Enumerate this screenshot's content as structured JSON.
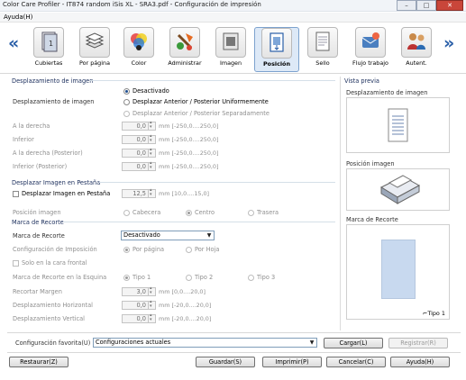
{
  "window": {
    "title": "Color Care Profiler - IT874 random iSis XL - SRA3.pdf - Configuración de impresión",
    "min": "–",
    "max": "□",
    "close": "✕"
  },
  "menu": {
    "help": "Ayuda(H)"
  },
  "toolbar": {
    "prev": "«",
    "next": "»",
    "items": [
      {
        "label": "Cubiertas",
        "icon": "cover-icon"
      },
      {
        "label": "Por página",
        "icon": "per-page-icon"
      },
      {
        "label": "Color",
        "icon": "color-icon"
      },
      {
        "label": "Administrar",
        "icon": "manage-icon"
      },
      {
        "label": "Imagen",
        "icon": "image-icon"
      },
      {
        "label": "Posición",
        "icon": "position-icon",
        "selected": true
      },
      {
        "label": "Sello",
        "icon": "stamp-icon"
      },
      {
        "label": "Flujo trabajo",
        "icon": "workflow-icon"
      },
      {
        "label": "Autent.",
        "icon": "authentication-icon"
      }
    ]
  },
  "image_shift": {
    "header": "Desplazamiento de imagen",
    "label": "Desplazamiento de imagen",
    "options": [
      "Desactivado",
      "Desplazar Anterior / Posterior Uniformemente",
      "Desplazar Anterior / Posterior Separadamente"
    ],
    "fields": [
      {
        "label": "A la derecha",
        "value": "0,0",
        "range": "mm [-250,0....250,0]"
      },
      {
        "label": "Inferior",
        "value": "0,0",
        "range": "mm [-250,0....250,0]"
      },
      {
        "label": "A la derecha (Posterior)",
        "value": "0,0",
        "range": "mm [-250,0....250,0]"
      },
      {
        "label": "Inferior (Posterior)",
        "value": "0,0",
        "range": "mm [-250,0....250,0]"
      }
    ]
  },
  "tab_shift": {
    "header": "Desplazar Imagen en Pestaña",
    "checkbox": "Desplazar Imagen en Pestaña",
    "value": "12,5",
    "range": "mm [10,0....15,0]",
    "position_label": "Posición imagen",
    "positions": [
      "Cabecera",
      "Centro",
      "Trasera"
    ]
  },
  "crop_marks": {
    "header": "Marca de Recorte",
    "label": "Marca de Recorte",
    "select_value": "Desactivado",
    "imposition_label": "Configuración de Imposición",
    "imposition_options": [
      "Por página",
      "Por Hoja"
    ],
    "front_only": "Solo en la cara frontal",
    "corner_label": "Marca de Recorte en la Esquina",
    "corner_types": [
      "Tipo 1",
      "Tipo 2",
      "Tipo 3"
    ],
    "fields": [
      {
        "label": "Recortar Margen",
        "value": "3,0",
        "range": "mm [0,0....20,0]"
      },
      {
        "label": "Desplazamiento Horizontal",
        "value": "0,0",
        "range": "mm [-20,0....20,0]"
      },
      {
        "label": "Desplazamiento Vertical",
        "value": "0,0",
        "range": "mm [-20,0....20,0]"
      }
    ]
  },
  "preview": {
    "header": "Vista previa",
    "shift_label": "Desplazamiento de imagen",
    "position_label": "Posición imagen",
    "crop_label": "Marca de Recorte",
    "crop_type": "Tipo 1"
  },
  "favorites": {
    "label": "Configuración favorita(U)",
    "value": "Configuraciones actuales",
    "load": "Cargar(L)",
    "register": "Registrar(R)"
  },
  "footer": {
    "restore": "Restaurar(Z)",
    "save": "Guardar(S)",
    "print": "Imprimir(P)",
    "cancel": "Cancelar(C)",
    "help": "Ayuda(H)"
  },
  "colors": {
    "accent": "#2a5fa8",
    "header_text": "#1b2e5c",
    "selected_tab_bg": "#dde9f7",
    "preview_page": "#c8d9ef"
  }
}
